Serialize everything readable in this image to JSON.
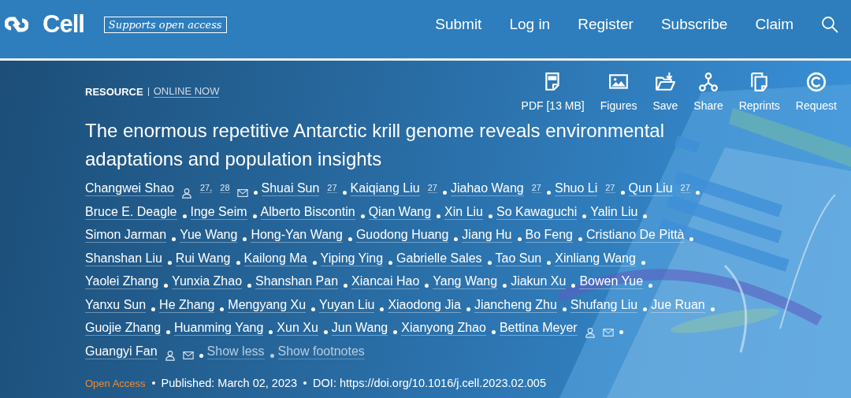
{
  "header": {
    "logo": "Cell",
    "badge": "Supports open access",
    "nav": [
      "Submit",
      "Log in",
      "Register",
      "Subscribe",
      "Claim"
    ]
  },
  "article": {
    "type": "RESOURCE",
    "status": "ONLINE NOW",
    "actions": [
      {
        "kind": "pdf",
        "label": "PDF [13 MB]"
      },
      {
        "kind": "figures",
        "label": "Figures"
      },
      {
        "kind": "save",
        "label": "Save"
      },
      {
        "kind": "share",
        "label": "Share"
      },
      {
        "kind": "reprints",
        "label": "Reprints"
      },
      {
        "kind": "request",
        "label": "Request"
      }
    ],
    "title": "The enormous repetitive Antarctic krill genome reveals environmental adaptations and population insights",
    "author_lines": [
      [
        {
          "name": "Changwei Shao",
          "contact": true,
          "sups": [
            "27,",
            "28"
          ],
          "email": true
        },
        {
          "name": "Shuai Sun",
          "sups": [
            "27"
          ]
        },
        {
          "name": "Kaiqiang Liu",
          "sups": [
            "27"
          ]
        },
        {
          "name": "Jiahao Wang",
          "sups": [
            "27"
          ]
        },
        {
          "name": "Shuo Li",
          "sups": [
            "27"
          ]
        },
        {
          "name": "Qun Liu",
          "sups": [
            "27"
          ]
        }
      ],
      [
        {
          "name": "Bruce E. Deagle"
        },
        {
          "name": "Inge Seim"
        },
        {
          "name": "Alberto Biscontin"
        },
        {
          "name": "Qian Wang"
        },
        {
          "name": "Xin Liu"
        },
        {
          "name": "So Kawaguchi"
        },
        {
          "name": "Yalin Liu"
        }
      ],
      [
        {
          "name": "Simon Jarman"
        },
        {
          "name": "Yue Wang"
        },
        {
          "name": "Hong-Yan Wang"
        },
        {
          "name": "Guodong Huang"
        },
        {
          "name": "Jiang Hu"
        },
        {
          "name": "Bo Feng"
        },
        {
          "name": "Cristiano De Pittà"
        }
      ],
      [
        {
          "name": "Shanshan Liu"
        },
        {
          "name": "Rui Wang"
        },
        {
          "name": "Kailong Ma"
        },
        {
          "name": "Yiping Ying"
        },
        {
          "name": "Gabrielle Sales"
        },
        {
          "name": "Tao Sun"
        },
        {
          "name": "Xinliang Wang"
        }
      ],
      [
        {
          "name": "Yaolei Zhang"
        },
        {
          "name": "Yunxia Zhao"
        },
        {
          "name": "Shanshan Pan"
        },
        {
          "name": "Xiancai Hao"
        },
        {
          "name": "Yang Wang"
        },
        {
          "name": "Jiakun Xu"
        },
        {
          "name": "Bowen Yue"
        }
      ],
      [
        {
          "name": "Yanxu Sun"
        },
        {
          "name": "He Zhang"
        },
        {
          "name": "Mengyang Xu"
        },
        {
          "name": "Yuyan Liu"
        },
        {
          "name": "Xiaodong Jia"
        },
        {
          "name": "Jiancheng Zhu"
        },
        {
          "name": "Shufang Liu"
        },
        {
          "name": "Jue Ruan"
        }
      ],
      [
        {
          "name": "Guojie Zhang"
        },
        {
          "name": "Huanming Yang"
        },
        {
          "name": "Xun Xu"
        },
        {
          "name": "Jun Wang"
        },
        {
          "name": "Xianyong Zhao"
        },
        {
          "name": "Bettina Meyer",
          "contact": true,
          "email": true
        }
      ],
      [
        {
          "name": "Guangyi Fan",
          "contact": true,
          "email": true
        }
      ]
    ],
    "author_links": [
      "Show less",
      "Show footnotes"
    ],
    "access": "Open Access",
    "published": "Published: March 02, 2023",
    "doi": "DOI: https://doi.org/10.1016/j.cell.2023.02.005"
  }
}
